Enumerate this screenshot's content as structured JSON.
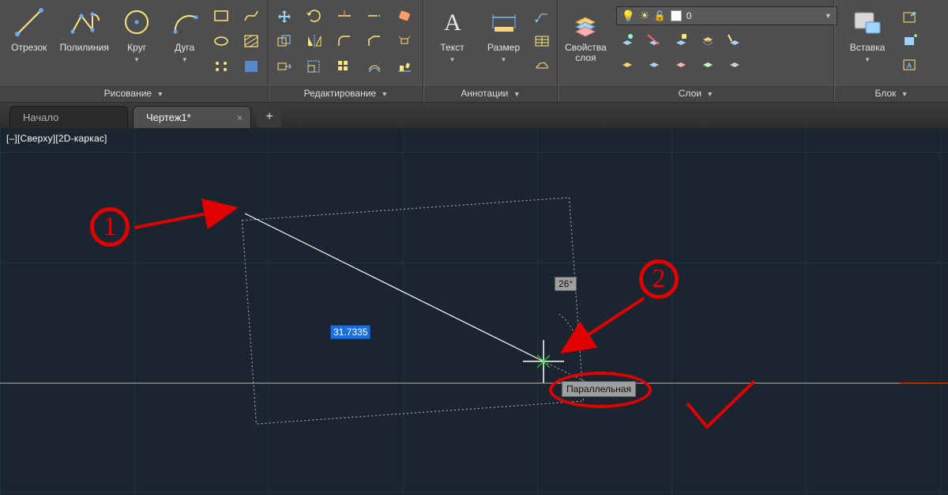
{
  "ribbon": {
    "draw": {
      "title": "Рисование",
      "line": "Отрезок",
      "polyline": "Полилиния",
      "circle": "Круг",
      "arc": "Дуга"
    },
    "edit": {
      "title": "Редактирование"
    },
    "anno": {
      "title": "Аннотации",
      "text": "Текст",
      "dim": "Размер"
    },
    "layers": {
      "title": "Слои",
      "props": "Свойства\nслоя",
      "current": "0"
    },
    "block": {
      "title": "Блок",
      "insert": "Вставка"
    }
  },
  "tabs": {
    "start": "Начало",
    "drawing": "Чертеж1*"
  },
  "canvas": {
    "viewlabel": "[–][Сверху][2D-каркас]",
    "dyn_length": "31.7335",
    "dyn_angle": "26°",
    "tooltip": "Параллельная"
  },
  "anno": {
    "n1": "1",
    "n2": "2"
  }
}
